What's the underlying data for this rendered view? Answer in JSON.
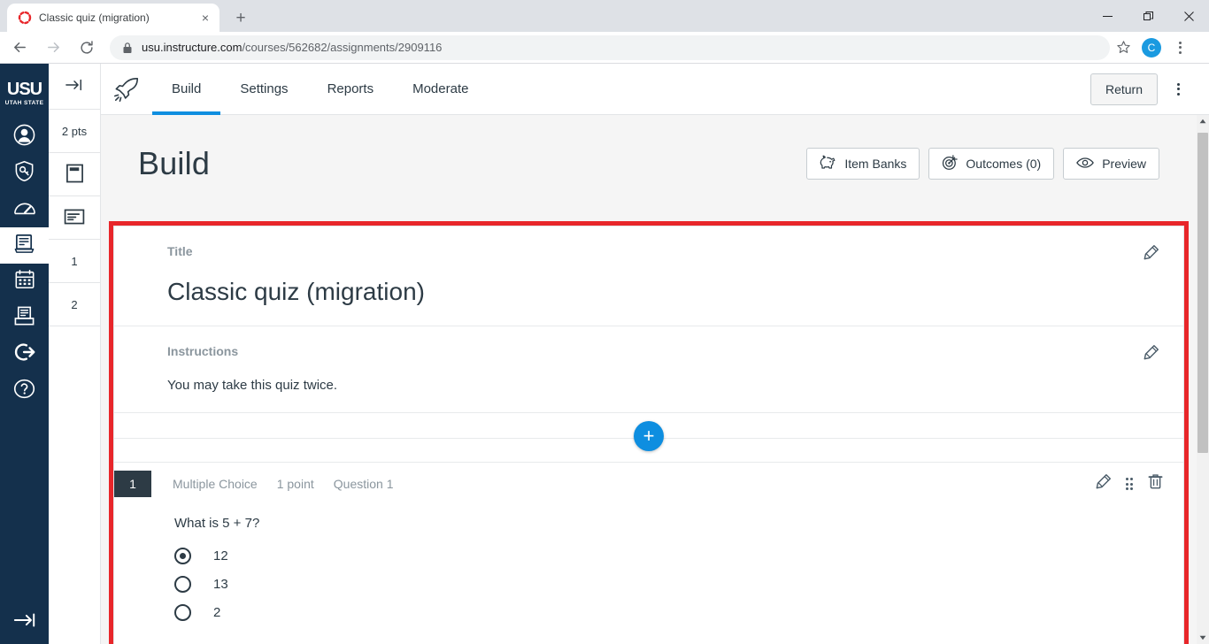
{
  "browser": {
    "tab": {
      "title": "Classic quiz (migration)",
      "favicon": "canvas-loading-icon",
      "close": "×"
    },
    "newtab_label": "+",
    "window_controls": [
      {
        "name": "minimize-button",
        "glyph": "minimize-icon"
      },
      {
        "name": "maximize-button",
        "glyph": "restore-icon"
      },
      {
        "name": "close-button",
        "glyph": "close-icon"
      }
    ],
    "nav": {
      "back": "back-arrow-icon",
      "forward": "forward-arrow-icon",
      "reload": "reload-icon"
    },
    "omnibox": {
      "lock": "lock-icon",
      "url_domain": "usu.instructure.com",
      "url_path": "/courses/562682/assignments/2909116",
      "url_full": "usu.instructure.com/courses/562682/assignments/2909116"
    },
    "toolbar_right": {
      "bookmark": "star-icon",
      "profile_initial": "C",
      "menu": "kebab-menu-icon"
    }
  },
  "global_nav": {
    "logo": {
      "mark": "USU",
      "subtitle": "UTAH STATE"
    },
    "items": [
      {
        "name": "account",
        "icon": "user-avatar-icon",
        "active": false
      },
      {
        "name": "admin",
        "icon": "shield-key-icon",
        "active": false
      },
      {
        "name": "dashboard",
        "icon": "gauge-icon",
        "active": false
      },
      {
        "name": "courses",
        "icon": "book-icon",
        "active": true
      },
      {
        "name": "calendar",
        "icon": "calendar-icon",
        "active": false
      },
      {
        "name": "inbox",
        "icon": "inbox-tray-icon",
        "active": false
      },
      {
        "name": "logout",
        "icon": "exit-arrow-icon",
        "active": false
      },
      {
        "name": "help",
        "icon": "question-circle-icon",
        "active": false
      }
    ],
    "collapse": "expand-arrow-icon"
  },
  "rail": {
    "expand": "expand-arrow-icon",
    "points": "2 pts",
    "items": [
      {
        "name": "title-block",
        "icon": "title-block-icon"
      },
      {
        "name": "instructions-block",
        "icon": "instructions-block-icon"
      },
      {
        "name": "question-1",
        "label": "1"
      },
      {
        "name": "question-2",
        "label": "2"
      }
    ]
  },
  "app_header": {
    "product_icon": "rocket-icon",
    "tabs": [
      {
        "label": "Build",
        "active": true
      },
      {
        "label": "Settings",
        "active": false
      },
      {
        "label": "Reports",
        "active": false
      },
      {
        "label": "Moderate",
        "active": false
      }
    ],
    "return_label": "Return",
    "menu": "kebab-menu-icon",
    "accent_color": "#0e8ee0"
  },
  "page": {
    "title": "Build",
    "actions": [
      {
        "label": "Item Banks",
        "icon": "piggy-bank-icon"
      },
      {
        "label": "Outcomes (0)",
        "icon": "target-icon"
      },
      {
        "label": "Preview",
        "icon": "eye-icon"
      }
    ],
    "highlight_color": "#e8262a"
  },
  "quiz": {
    "title_section": {
      "label": "Title",
      "value": "Classic quiz (migration)",
      "edit_icon": "pencil-icon"
    },
    "instructions_section": {
      "label": "Instructions",
      "value": "You may take this quiz twice.",
      "edit_icon": "pencil-icon"
    },
    "add_button": {
      "label": "+",
      "name": "add-item-button"
    },
    "questions": [
      {
        "number": "1",
        "type": "Multiple Choice",
        "points": "1 point",
        "name": "Question 1",
        "prompt": "What is 5 + 7?",
        "options": [
          {
            "label": "12",
            "selected": true
          },
          {
            "label": "13",
            "selected": false
          },
          {
            "label": "2",
            "selected": false
          }
        ],
        "actions": {
          "edit": "pencil-icon",
          "drag": "drag-handle-icon",
          "delete": "trash-icon"
        }
      }
    ]
  },
  "scrollbar": {
    "up": "scroll-up-arrow-icon",
    "down": "scroll-down-arrow-icon",
    "thumb": "scrollbar-thumb"
  }
}
